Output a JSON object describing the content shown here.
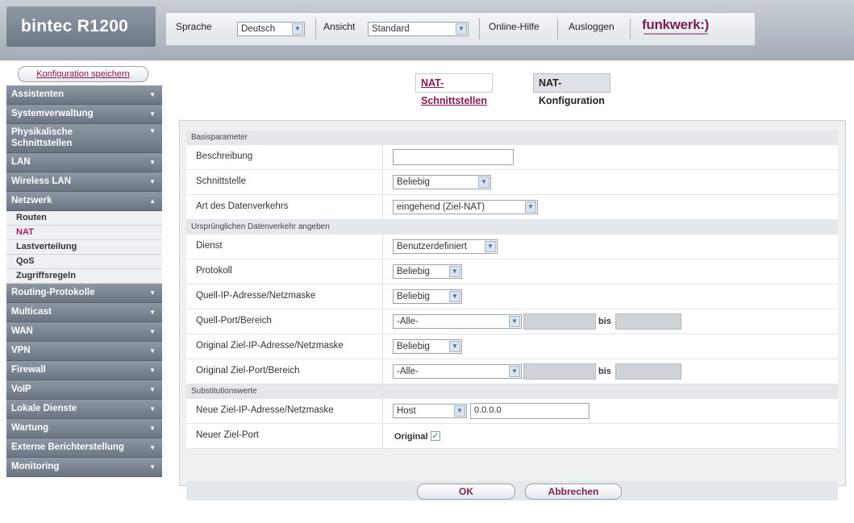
{
  "header": {
    "brand": "bintec R1200",
    "language_label": "Sprache",
    "language_value": "Deutsch",
    "view_label": "Ansicht",
    "view_value": "Standard",
    "help_link": "Online-Hilfe",
    "logout_link": "Ausloggen",
    "logo_text": "funkwerk:)"
  },
  "sidebar": {
    "save_button": "Konfiguration speichern",
    "items": [
      {
        "label": "Assistenten"
      },
      {
        "label": "Systemverwaltung"
      },
      {
        "label": "Physikalische Schnittstellen"
      },
      {
        "label": "LAN"
      },
      {
        "label": "Wireless LAN"
      },
      {
        "label": "Netzwerk"
      },
      {
        "label": "Routing-Protokolle"
      },
      {
        "label": "Multicast"
      },
      {
        "label": "WAN"
      },
      {
        "label": "VPN"
      },
      {
        "label": "Firewall"
      },
      {
        "label": "VoIP"
      },
      {
        "label": "Lokale Dienste"
      },
      {
        "label": "Wartung"
      },
      {
        "label": "Externe Berichterstellung"
      },
      {
        "label": "Monitoring"
      }
    ],
    "subitems": [
      {
        "label": "Routen"
      },
      {
        "label": "NAT"
      },
      {
        "label": "Lastverteilung"
      },
      {
        "label": "QoS"
      },
      {
        "label": "Zugriffsregeln"
      }
    ]
  },
  "tabs": {
    "tab1": "NAT-Schnittstellen",
    "tab2": "NAT-Konfiguration"
  },
  "form": {
    "sections": {
      "basic": "Basisparameter",
      "original": "Ursprünglichen Datenverkehr angeben",
      "subst": "Substitutionswerte"
    },
    "fields": {
      "beschreibung": {
        "label": "Beschreibung",
        "value": ""
      },
      "schnittstelle": {
        "label": "Schnittstelle",
        "value": "Beliebig"
      },
      "art": {
        "label": "Art des Datenverkehrs",
        "value": "eingehend (Ziel-NAT)"
      },
      "dienst": {
        "label": "Dienst",
        "value": "Benutzerdefiniert"
      },
      "protokoll": {
        "label": "Protokoll",
        "value": "Beliebig"
      },
      "quell_ip": {
        "label": "Quell-IP-Adresse/Netzmaske",
        "value": "Beliebig"
      },
      "quell_port": {
        "label": "Quell-Port/Bereich",
        "value": "-Alle-",
        "bis": "bis"
      },
      "orig_ziel_ip": {
        "label": "Original Ziel-IP-Adresse/Netzmaske",
        "value": "Beliebig"
      },
      "orig_ziel_port": {
        "label": "Original Ziel-Port/Bereich",
        "value": "-Alle-",
        "bis": "bis"
      },
      "neue_ziel_ip": {
        "label": "Neue Ziel-IP-Adresse/Netzmaske",
        "value": "Host",
        "ip": "0.0.0.0"
      },
      "neuer_port": {
        "label": "Neuer Ziel-Port",
        "checkbox_label": "Original",
        "checked": true
      }
    },
    "buttons": {
      "ok": "OK",
      "cancel": "Abbrechen"
    }
  }
}
